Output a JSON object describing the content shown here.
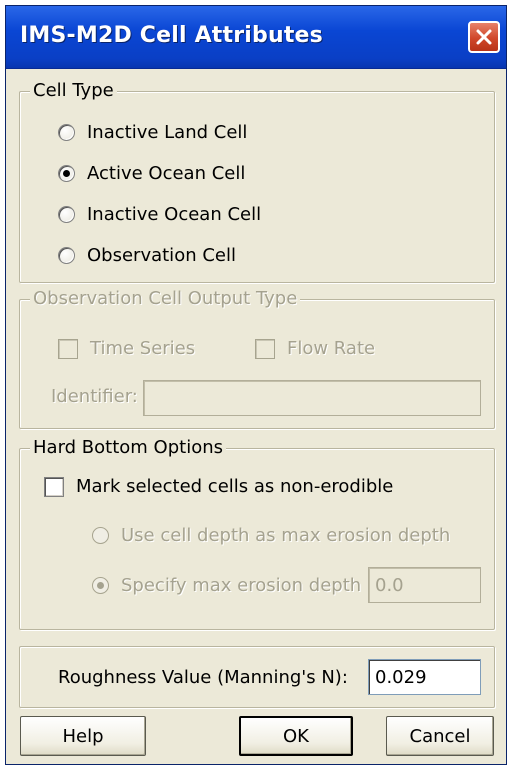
{
  "window": {
    "title": "IMS-M2D Cell Attributes"
  },
  "cell_type": {
    "legend": "Cell Type",
    "options": [
      {
        "label": "Inactive Land Cell",
        "checked": false
      },
      {
        "label": "Active Ocean Cell",
        "checked": true
      },
      {
        "label": "Inactive Ocean Cell",
        "checked": false
      },
      {
        "label": "Observation Cell",
        "checked": false
      }
    ]
  },
  "observation_output": {
    "legend": "Observation Cell Output Type",
    "time_series_label": "Time Series",
    "flow_rate_label": "Flow Rate",
    "identifier_label": "Identifier:",
    "identifier_value": ""
  },
  "hard_bottom": {
    "legend": "Hard Bottom Options",
    "non_erodible_label": "Mark selected cells as non-erodible",
    "use_cell_depth_label": "Use cell depth as max erosion depth",
    "specify_depth_label": "Specify max erosion depth",
    "max_depth_value": "0.0"
  },
  "roughness": {
    "label": "Roughness Value (Manning's N):",
    "value": "0.029"
  },
  "buttons": {
    "help": "Help",
    "ok": "OK",
    "cancel": "Cancel"
  }
}
